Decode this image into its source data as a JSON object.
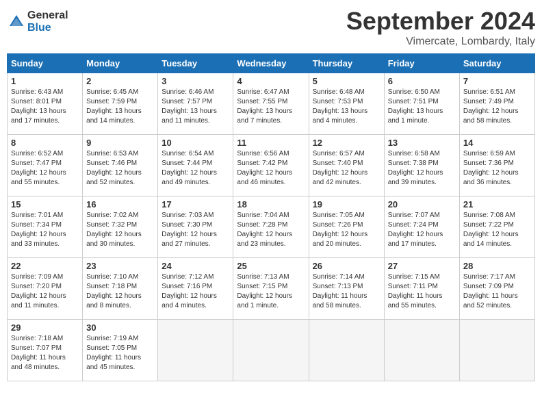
{
  "header": {
    "logo_line1": "General",
    "logo_line2": "Blue",
    "month_title": "September 2024",
    "subtitle": "Vimercate, Lombardy, Italy"
  },
  "weekdays": [
    "Sunday",
    "Monday",
    "Tuesday",
    "Wednesday",
    "Thursday",
    "Friday",
    "Saturday"
  ],
  "days": [
    {
      "num": "",
      "info": ""
    },
    {
      "num": "",
      "info": ""
    },
    {
      "num": "",
      "info": ""
    },
    {
      "num": "",
      "info": ""
    },
    {
      "num": "",
      "info": ""
    },
    {
      "num": "",
      "info": ""
    },
    {
      "num": "",
      "info": ""
    },
    {
      "num": "1",
      "info": "Sunrise: 6:43 AM\nSunset: 8:01 PM\nDaylight: 13 hours and 17 minutes."
    },
    {
      "num": "2",
      "info": "Sunrise: 6:45 AM\nSunset: 7:59 PM\nDaylight: 13 hours and 14 minutes."
    },
    {
      "num": "3",
      "info": "Sunrise: 6:46 AM\nSunset: 7:57 PM\nDaylight: 13 hours and 11 minutes."
    },
    {
      "num": "4",
      "info": "Sunrise: 6:47 AM\nSunset: 7:55 PM\nDaylight: 13 hours and 7 minutes."
    },
    {
      "num": "5",
      "info": "Sunrise: 6:48 AM\nSunset: 7:53 PM\nDaylight: 13 hours and 4 minutes."
    },
    {
      "num": "6",
      "info": "Sunrise: 6:50 AM\nSunset: 7:51 PM\nDaylight: 13 hours and 1 minute."
    },
    {
      "num": "7",
      "info": "Sunrise: 6:51 AM\nSunset: 7:49 PM\nDaylight: 12 hours and 58 minutes."
    },
    {
      "num": "8",
      "info": "Sunrise: 6:52 AM\nSunset: 7:47 PM\nDaylight: 12 hours and 55 minutes."
    },
    {
      "num": "9",
      "info": "Sunrise: 6:53 AM\nSunset: 7:46 PM\nDaylight: 12 hours and 52 minutes."
    },
    {
      "num": "10",
      "info": "Sunrise: 6:54 AM\nSunset: 7:44 PM\nDaylight: 12 hours and 49 minutes."
    },
    {
      "num": "11",
      "info": "Sunrise: 6:56 AM\nSunset: 7:42 PM\nDaylight: 12 hours and 46 minutes."
    },
    {
      "num": "12",
      "info": "Sunrise: 6:57 AM\nSunset: 7:40 PM\nDaylight: 12 hours and 42 minutes."
    },
    {
      "num": "13",
      "info": "Sunrise: 6:58 AM\nSunset: 7:38 PM\nDaylight: 12 hours and 39 minutes."
    },
    {
      "num": "14",
      "info": "Sunrise: 6:59 AM\nSunset: 7:36 PM\nDaylight: 12 hours and 36 minutes."
    },
    {
      "num": "15",
      "info": "Sunrise: 7:01 AM\nSunset: 7:34 PM\nDaylight: 12 hours and 33 minutes."
    },
    {
      "num": "16",
      "info": "Sunrise: 7:02 AM\nSunset: 7:32 PM\nDaylight: 12 hours and 30 minutes."
    },
    {
      "num": "17",
      "info": "Sunrise: 7:03 AM\nSunset: 7:30 PM\nDaylight: 12 hours and 27 minutes."
    },
    {
      "num": "18",
      "info": "Sunrise: 7:04 AM\nSunset: 7:28 PM\nDaylight: 12 hours and 23 minutes."
    },
    {
      "num": "19",
      "info": "Sunrise: 7:05 AM\nSunset: 7:26 PM\nDaylight: 12 hours and 20 minutes."
    },
    {
      "num": "20",
      "info": "Sunrise: 7:07 AM\nSunset: 7:24 PM\nDaylight: 12 hours and 17 minutes."
    },
    {
      "num": "21",
      "info": "Sunrise: 7:08 AM\nSunset: 7:22 PM\nDaylight: 12 hours and 14 minutes."
    },
    {
      "num": "22",
      "info": "Sunrise: 7:09 AM\nSunset: 7:20 PM\nDaylight: 12 hours and 11 minutes."
    },
    {
      "num": "23",
      "info": "Sunrise: 7:10 AM\nSunset: 7:18 PM\nDaylight: 12 hours and 8 minutes."
    },
    {
      "num": "24",
      "info": "Sunrise: 7:12 AM\nSunset: 7:16 PM\nDaylight: 12 hours and 4 minutes."
    },
    {
      "num": "25",
      "info": "Sunrise: 7:13 AM\nSunset: 7:15 PM\nDaylight: 12 hours and 1 minute."
    },
    {
      "num": "26",
      "info": "Sunrise: 7:14 AM\nSunset: 7:13 PM\nDaylight: 11 hours and 58 minutes."
    },
    {
      "num": "27",
      "info": "Sunrise: 7:15 AM\nSunset: 7:11 PM\nDaylight: 11 hours and 55 minutes."
    },
    {
      "num": "28",
      "info": "Sunrise: 7:17 AM\nSunset: 7:09 PM\nDaylight: 11 hours and 52 minutes."
    },
    {
      "num": "29",
      "info": "Sunrise: 7:18 AM\nSunset: 7:07 PM\nDaylight: 11 hours and 48 minutes."
    },
    {
      "num": "30",
      "info": "Sunrise: 7:19 AM\nSunset: 7:05 PM\nDaylight: 11 hours and 45 minutes."
    },
    {
      "num": "",
      "info": ""
    },
    {
      "num": "",
      "info": ""
    },
    {
      "num": "",
      "info": ""
    },
    {
      "num": "",
      "info": ""
    },
    {
      "num": "",
      "info": ""
    }
  ]
}
